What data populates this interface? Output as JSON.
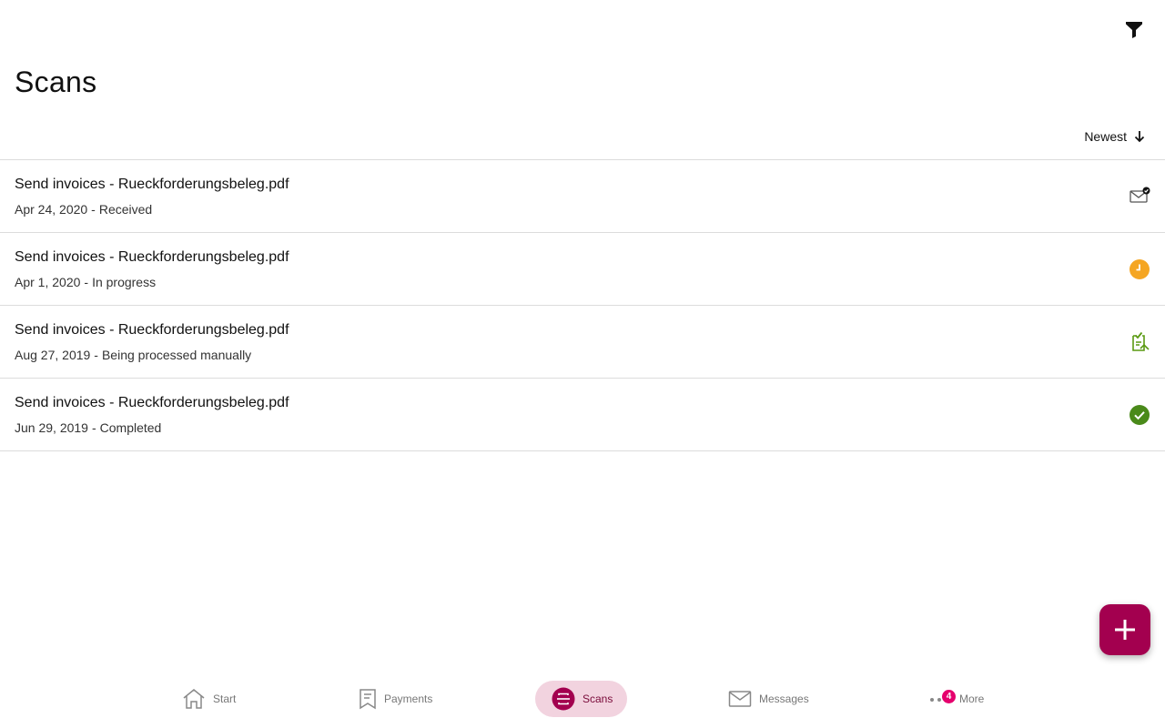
{
  "header": {
    "title": "Scans",
    "filter_icon": "filter-icon"
  },
  "sort": {
    "label": "Newest",
    "icon": "arrow-down-icon"
  },
  "scans": [
    {
      "title": "Send invoices - Rueckforderungsbeleg.pdf",
      "date": "Apr 24, 2020",
      "status": "Received",
      "icon": "envelope-check-icon",
      "color": "#555555"
    },
    {
      "title": "Send invoices - Rueckforderungsbeleg.pdf",
      "date": "Apr 1, 2020",
      "status": "In progress",
      "icon": "clock-icon",
      "color": "#f5a623"
    },
    {
      "title": "Send invoices - Rueckforderungsbeleg.pdf",
      "date": "Aug 27, 2019",
      "status": "Being processed manually",
      "icon": "document-review-icon",
      "color": "#5a9a12"
    },
    {
      "title": "Send invoices - Rueckforderungsbeleg.pdf",
      "date": "Jun 29, 2019",
      "status": "Completed",
      "icon": "check-circle-icon",
      "color": "#4a8a1a"
    }
  ],
  "fab": {
    "icon": "plus-icon",
    "color": "#a3004f"
  },
  "nav": [
    {
      "label": "Start",
      "icon": "home-icon"
    },
    {
      "label": "Payments",
      "icon": "receipt-icon"
    },
    {
      "label": "Scans",
      "icon": "scan-icon",
      "active": true
    },
    {
      "label": "Messages",
      "icon": "mail-icon"
    },
    {
      "label": "More",
      "icon": "more-icon",
      "badge": "4"
    }
  ],
  "colors": {
    "accent": "#a3004f",
    "active_nav_bg": "#f2d3df",
    "badge": "#e5006d"
  }
}
